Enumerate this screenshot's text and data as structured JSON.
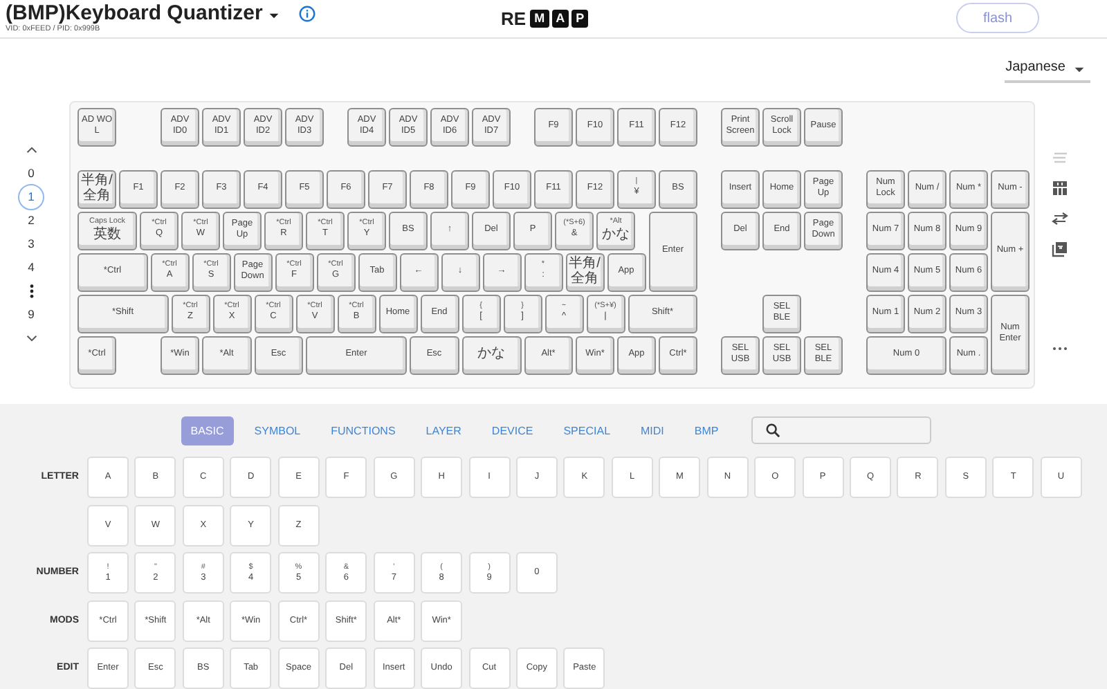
{
  "header": {
    "title": "(BMP)Keyboard Quantizer",
    "ids": "VID: 0xFEED / PID: 0x999B",
    "logo": {
      "plain": "RE",
      "boxed": [
        "M",
        "A",
        "P"
      ]
    },
    "flash": {
      "label": "flash",
      "disabled": true
    }
  },
  "language": "Japanese",
  "layers": [
    {
      "kind": "layer",
      "label": "0",
      "selected": false
    },
    {
      "kind": "layer",
      "label": "1",
      "selected": true
    },
    {
      "kind": "layer",
      "label": "2",
      "selected": false
    },
    {
      "kind": "layer",
      "label": "3",
      "selected": false
    },
    {
      "kind": "layer",
      "label": "4",
      "selected": false
    },
    {
      "kind": "more"
    },
    {
      "kind": "layer",
      "label": "9",
      "selected": false
    }
  ],
  "keyboard": {
    "keys": [
      {
        "main": "AD WO L"
      },
      {
        "main": "ADV ID0"
      },
      {
        "main": "ADV ID1"
      },
      {
        "main": "ADV ID2"
      },
      {
        "main": "ADV ID3"
      },
      {
        "main": "ADV ID4"
      },
      {
        "main": "ADV ID5"
      },
      {
        "main": "ADV ID6"
      },
      {
        "main": "ADV ID7"
      },
      {
        "main": "F9"
      },
      {
        "main": "F10"
      },
      {
        "main": "F11"
      },
      {
        "main": "F12"
      },
      {
        "main": "Print Screen"
      },
      {
        "main": "Scroll Lock"
      },
      {
        "main": "Pause"
      },
      {
        "main": "半角/全角"
      },
      {
        "main": "F1"
      },
      {
        "main": "F2"
      },
      {
        "main": "F3"
      },
      {
        "main": "F4"
      },
      {
        "main": "F5"
      },
      {
        "main": "F6"
      },
      {
        "main": "F7"
      },
      {
        "main": "F8"
      },
      {
        "main": "F9"
      },
      {
        "main": "F10"
      },
      {
        "main": "F11"
      },
      {
        "main": "F12"
      },
      {
        "top": "|",
        "main": "¥"
      },
      {
        "main": "BS"
      },
      {
        "main": "Insert"
      },
      {
        "main": "Home"
      },
      {
        "main": "Page Up"
      },
      {
        "main": "Num Lock"
      },
      {
        "main": "Num /"
      },
      {
        "main": "Num *"
      },
      {
        "main": "Num -"
      },
      {
        "top": "Caps Lock",
        "main": "英数"
      },
      {
        "top": "*Ctrl",
        "main": "Q"
      },
      {
        "top": "*Ctrl",
        "main": "W"
      },
      {
        "main": "Page Up"
      },
      {
        "top": "*Ctrl",
        "main": "R"
      },
      {
        "top": "*Ctrl",
        "main": "T"
      },
      {
        "top": "*Ctrl",
        "main": "Y"
      },
      {
        "main": "BS"
      },
      {
        "main": "↑"
      },
      {
        "main": "Del"
      },
      {
        "main": "P"
      },
      {
        "top": "(*S+6)",
        "main": "&"
      },
      {
        "top": "*Alt",
        "main": "かな"
      },
      {
        "main": "Enter"
      },
      {
        "main": "Del"
      },
      {
        "main": "End"
      },
      {
        "main": "Page Down"
      },
      {
        "main": "Num 7"
      },
      {
        "main": "Num 8"
      },
      {
        "main": "Num 9"
      },
      {
        "main": "Num +"
      },
      {
        "main": "*Ctrl"
      },
      {
        "top": "*Ctrl",
        "main": "A"
      },
      {
        "top": "*Ctrl",
        "main": "S"
      },
      {
        "main": "Page Down"
      },
      {
        "top": "*Ctrl",
        "main": "F"
      },
      {
        "top": "*Ctrl",
        "main": "G"
      },
      {
        "main": "Tab"
      },
      {
        "main": "←"
      },
      {
        "main": "↓"
      },
      {
        "main": "→"
      },
      {
        "top": "*",
        "main": ":"
      },
      {
        "main": "半角/全角"
      },
      {
        "main": "App"
      },
      {
        "main": "Num 4"
      },
      {
        "main": "Num 5"
      },
      {
        "main": "Num 6"
      },
      {
        "main": "*Shift"
      },
      {
        "top": "*Ctrl",
        "main": "Z"
      },
      {
        "top": "*Ctrl",
        "main": "X"
      },
      {
        "top": "*Ctrl",
        "main": "C"
      },
      {
        "top": "*Ctrl",
        "main": "V"
      },
      {
        "top": "*Ctrl",
        "main": "B"
      },
      {
        "main": "Home"
      },
      {
        "main": "End"
      },
      {
        "top": "{",
        "main": "["
      },
      {
        "top": "}",
        "main": "]"
      },
      {
        "top": "~",
        "main": "^"
      },
      {
        "top": "(*S+¥)",
        "main": "|"
      },
      {
        "main": "Shift*"
      },
      {
        "main": "SEL BLE"
      },
      {
        "main": "Num 1"
      },
      {
        "main": "Num 2"
      },
      {
        "main": "Num 3"
      },
      {
        "main": "Num Enter"
      },
      {
        "main": "*Ctrl"
      },
      {
        "main": "*Win"
      },
      {
        "main": "*Alt"
      },
      {
        "main": "Esc"
      },
      {
        "main": "Enter"
      },
      {
        "main": "Esc"
      },
      {
        "main": "かな"
      },
      {
        "main": "Alt*"
      },
      {
        "main": "Win*"
      },
      {
        "main": "App"
      },
      {
        "main": "Ctrl*"
      },
      {
        "main": "SEL USB"
      },
      {
        "main": "SEL USB"
      },
      {
        "main": "SEL BLE"
      },
      {
        "main": "Num 0"
      },
      {
        "main": "Num ."
      }
    ]
  },
  "palette": {
    "tabs": [
      {
        "label": "BASIC",
        "selected": true
      },
      {
        "label": "SYMBOL",
        "selected": false
      },
      {
        "label": "FUNCTIONS",
        "selected": false
      },
      {
        "label": "LAYER",
        "selected": false
      },
      {
        "label": "DEVICE",
        "selected": false
      },
      {
        "label": "SPECIAL",
        "selected": false
      },
      {
        "label": "MIDI",
        "selected": false
      },
      {
        "label": "BMP",
        "selected": false
      }
    ],
    "groups": [
      {
        "label": "LETTER",
        "keys": [
          {
            "main": "A"
          },
          {
            "main": "B"
          },
          {
            "main": "C"
          },
          {
            "main": "D"
          },
          {
            "main": "E"
          },
          {
            "main": "F"
          },
          {
            "main": "G"
          },
          {
            "main": "H"
          },
          {
            "main": "I"
          },
          {
            "main": "J"
          },
          {
            "main": "K"
          },
          {
            "main": "L"
          },
          {
            "main": "M"
          },
          {
            "main": "N"
          },
          {
            "main": "O"
          },
          {
            "main": "P"
          },
          {
            "main": "Q"
          },
          {
            "main": "R"
          },
          {
            "main": "S"
          },
          {
            "main": "T"
          },
          {
            "main": "U"
          },
          {
            "main": "V"
          },
          {
            "main": "W"
          },
          {
            "main": "X"
          },
          {
            "main": "Y"
          },
          {
            "main": "Z"
          }
        ]
      },
      {
        "label": "NUMBER",
        "keys": [
          {
            "top": "!",
            "main": "1"
          },
          {
            "top": "\"",
            "main": "2"
          },
          {
            "top": "#",
            "main": "3"
          },
          {
            "top": "$",
            "main": "4"
          },
          {
            "top": "%",
            "main": "5"
          },
          {
            "top": "&",
            "main": "6"
          },
          {
            "top": "'",
            "main": "7"
          },
          {
            "top": "(",
            "main": "8"
          },
          {
            "top": ")",
            "main": "9"
          },
          {
            "main": "0"
          }
        ]
      },
      {
        "label": "MODS",
        "keys": [
          {
            "main": "*Ctrl"
          },
          {
            "main": "*Shift"
          },
          {
            "main": "*Alt"
          },
          {
            "main": "*Win"
          },
          {
            "main": "Ctrl*"
          },
          {
            "main": "Shift*"
          },
          {
            "main": "Alt*"
          },
          {
            "main": "Win*"
          }
        ]
      },
      {
        "label": "EDIT",
        "keys": [
          {
            "main": "Enter"
          },
          {
            "main": "Esc"
          },
          {
            "main": "BS"
          },
          {
            "main": "Tab"
          },
          {
            "main": "Space"
          },
          {
            "main": "Del"
          },
          {
            "main": "Insert"
          },
          {
            "main": "Undo"
          },
          {
            "main": "Cut"
          },
          {
            "main": "Copy"
          },
          {
            "main": "Paste"
          }
        ]
      }
    ]
  }
}
